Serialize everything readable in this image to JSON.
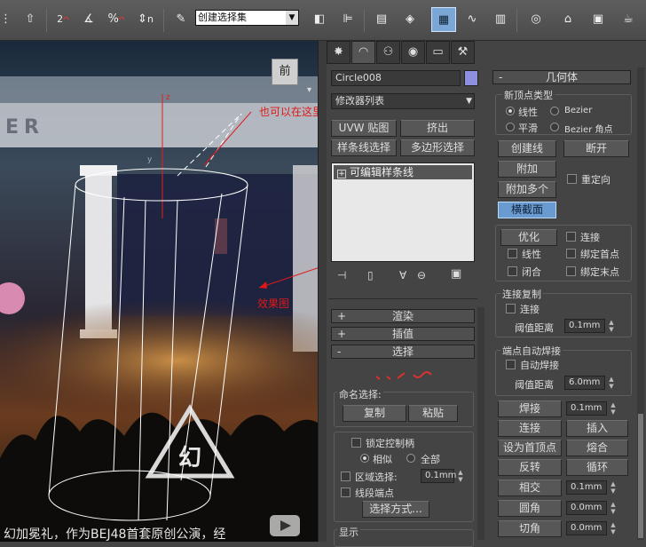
{
  "toolbar": {
    "snap_2": "2",
    "snap_n": "n",
    "percent": "%",
    "snap_spinner": "n",
    "selection_set": "创建选择集"
  },
  "viewport": {
    "viewcube_label": "前",
    "menu_marker": "▾",
    "video_caption": "幻加冕礼，作为BEJ48首套原创公演，经",
    "stage_sign": "ER",
    "axis_z": "z",
    "axis_y": "y"
  },
  "annotations": {
    "hint": "也可以在这里附加多个，然后连接多个横截面",
    "effect": "效果图"
  },
  "command_panel": {
    "object_name": "Circle008",
    "object_color": "#8f8fdf",
    "modifier_list": "修改器列表",
    "uvw_map": "UVW 贴图",
    "extrude": "挤出",
    "spline_select": "样条线选择",
    "poly_select": "多边形选择",
    "stack_item": "可编辑样条线",
    "stack_expand": "+",
    "rollouts": {
      "render": "渲染",
      "interp": "插值",
      "selection": "选择"
    },
    "named_selection": "命名选择:",
    "copy": "复制",
    "paste": "粘贴",
    "lock_handles": "锁定控制柄",
    "similar": "相似",
    "all": "全部",
    "area_select": "区域选择:",
    "area_value": "0.1mm",
    "segment_end": "线段端点",
    "select_by": "选择方式...",
    "display": "显示"
  },
  "geometry": {
    "title": "几何体",
    "new_vertex_type": "新顶点类型",
    "linear": "线性",
    "bezier": "Bezier",
    "smooth": "平滑",
    "bezier_corner": "Bezier 角点",
    "create_line": "创建线",
    "break": "断开",
    "attach": "附加",
    "reorient": "重定向",
    "attach_mult": "附加多个",
    "cross_section": "横截面",
    "refine": "优化",
    "connect": "连接",
    "linear2": "线性",
    "bind_first": "绑定首点",
    "closed": "闭合",
    "bind_last": "绑定末点",
    "connect_copy": "连接复制",
    "connect2": "连接",
    "threshold": "阈值距离",
    "threshold_val": "0.1mm",
    "end_weld": "端点自动焊接",
    "auto_weld": "自动焊接",
    "threshold2": "阈值距离",
    "threshold_val2": "6.0mm",
    "weld": "焊接",
    "weld_val": "0.1mm",
    "connect3": "连接",
    "insert": "插入",
    "make_first": "设为首顶点",
    "fuse": "熔合",
    "reverse": "反转",
    "cycle": "循环",
    "intersect": "相交",
    "intersect_val": "0.1mm",
    "fillet": "圆角",
    "fillet_val": "0.0mm",
    "chamfer": "切角",
    "chamfer_val": "0.0mm"
  }
}
